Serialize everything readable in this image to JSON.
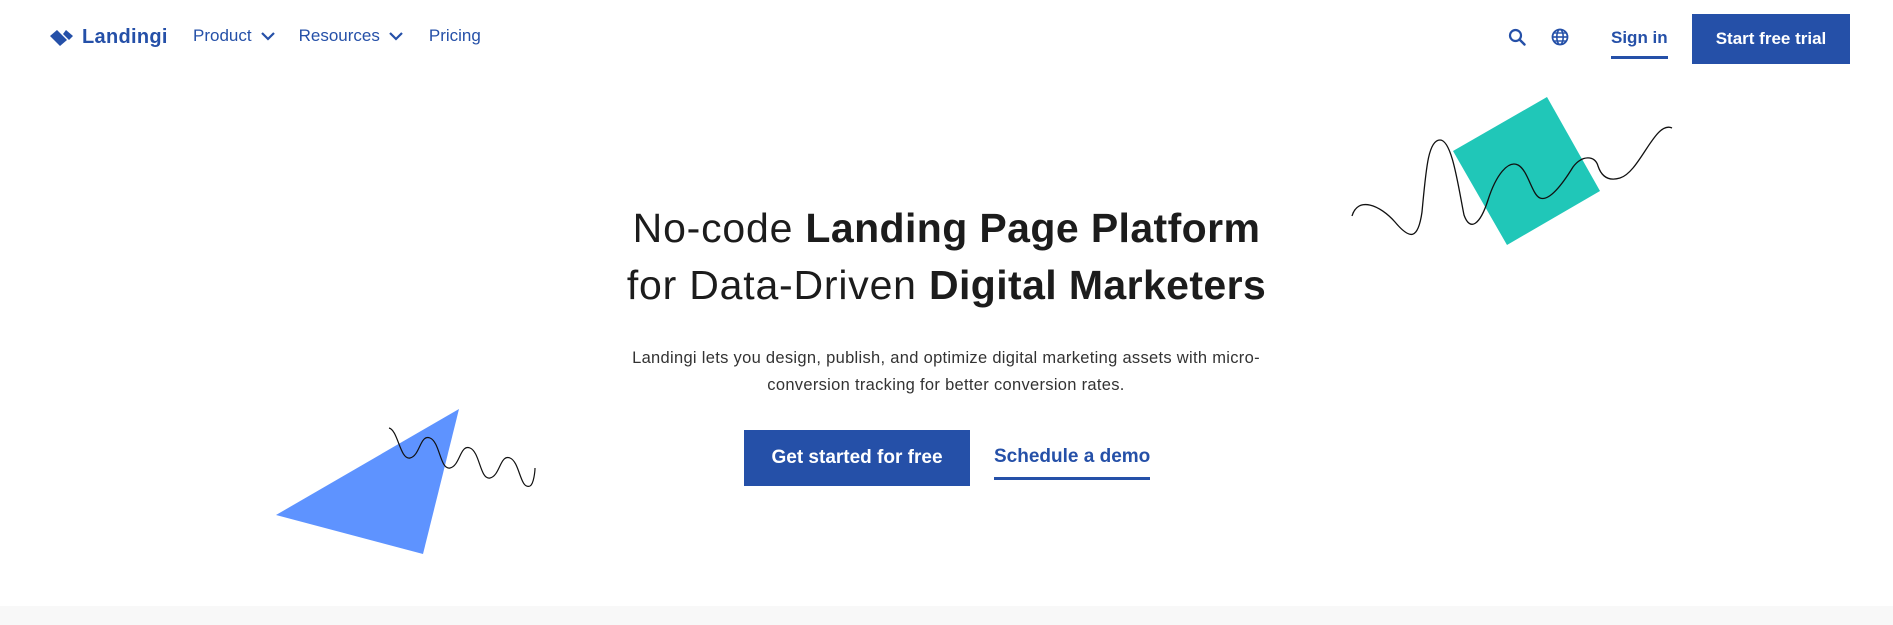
{
  "header": {
    "logo_text": "Landingi",
    "nav": [
      {
        "label": "Product",
        "has_dropdown": true
      },
      {
        "label": "Resources",
        "has_dropdown": true
      },
      {
        "label": "Pricing",
        "has_dropdown": false
      }
    ],
    "icons": [
      "search-icon",
      "globe-icon"
    ],
    "sign_in_label": "Sign in",
    "trial_label": "Start free trial"
  },
  "hero": {
    "headline": {
      "line1_light": "No-code ",
      "line1_bold": "Landing Page Platform",
      "line2_light": "for Data-Driven ",
      "line2_bold": "Digital Marketers"
    },
    "subtext": "Landingi lets you design, publish, and optimize digital marketing assets with micro-conversion tracking for better conversion rates.",
    "cta_primary": "Get started for free",
    "cta_secondary": "Schedule a demo"
  },
  "colors": {
    "brand_blue": "#2550a8",
    "teal_square": "#20c7b8",
    "light_blue_triangle": "#5e93ff",
    "footer_band": "#f8f8f8"
  }
}
